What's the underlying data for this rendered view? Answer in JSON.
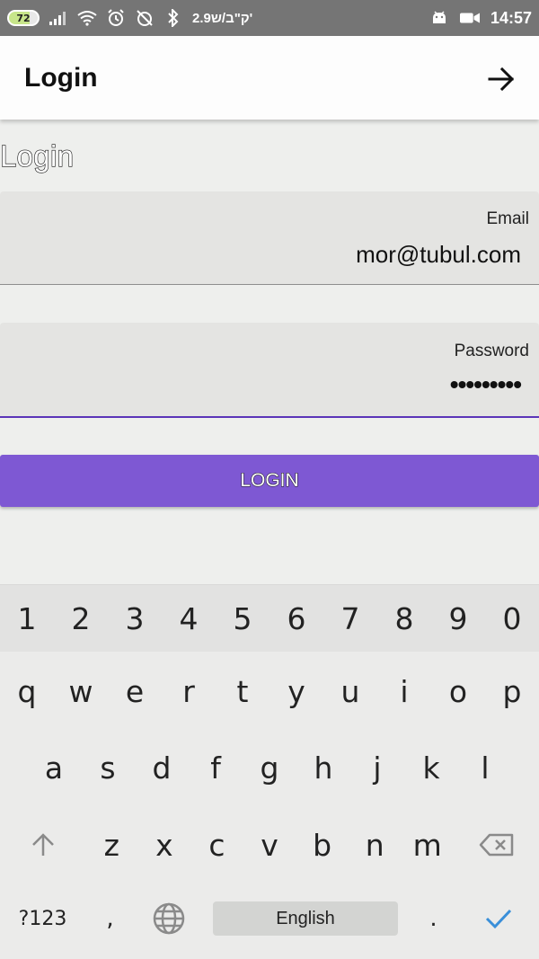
{
  "status_bar": {
    "battery": "72",
    "speed": "2.9ק\"ב/ש'",
    "time": "14:57",
    "icons": [
      "signal-icon",
      "wifi-icon",
      "alarm-icon",
      "alarm-off-icon",
      "bluetooth-icon",
      "android-icon",
      "video-icon"
    ]
  },
  "app_bar": {
    "title": "Login",
    "action_icon": "arrow-right-icon"
  },
  "form": {
    "heading": "Login",
    "email": {
      "label": "Email",
      "value": "mor@tubul.com"
    },
    "password": {
      "label": "Password",
      "value": "•••••••••"
    },
    "submit_label": "LOGIN"
  },
  "keyboard": {
    "number_row": [
      "1",
      "2",
      "3",
      "4",
      "5",
      "6",
      "7",
      "8",
      "9",
      "0"
    ],
    "row1": [
      "q",
      "w",
      "e",
      "r",
      "t",
      "y",
      "u",
      "i",
      "o",
      "p"
    ],
    "row2": [
      "a",
      "s",
      "d",
      "f",
      "g",
      "h",
      "j",
      "k",
      "l"
    ],
    "row3": [
      "z",
      "x",
      "c",
      "v",
      "b",
      "n",
      "m"
    ],
    "symbols_label": "?123",
    "comma": ",",
    "space_label": "English",
    "period": "."
  },
  "colors": {
    "accent": "#7e58d3",
    "focus_underline": "#5b34b8",
    "status_bar": "#757575",
    "field_bg": "#e4e4e2"
  }
}
